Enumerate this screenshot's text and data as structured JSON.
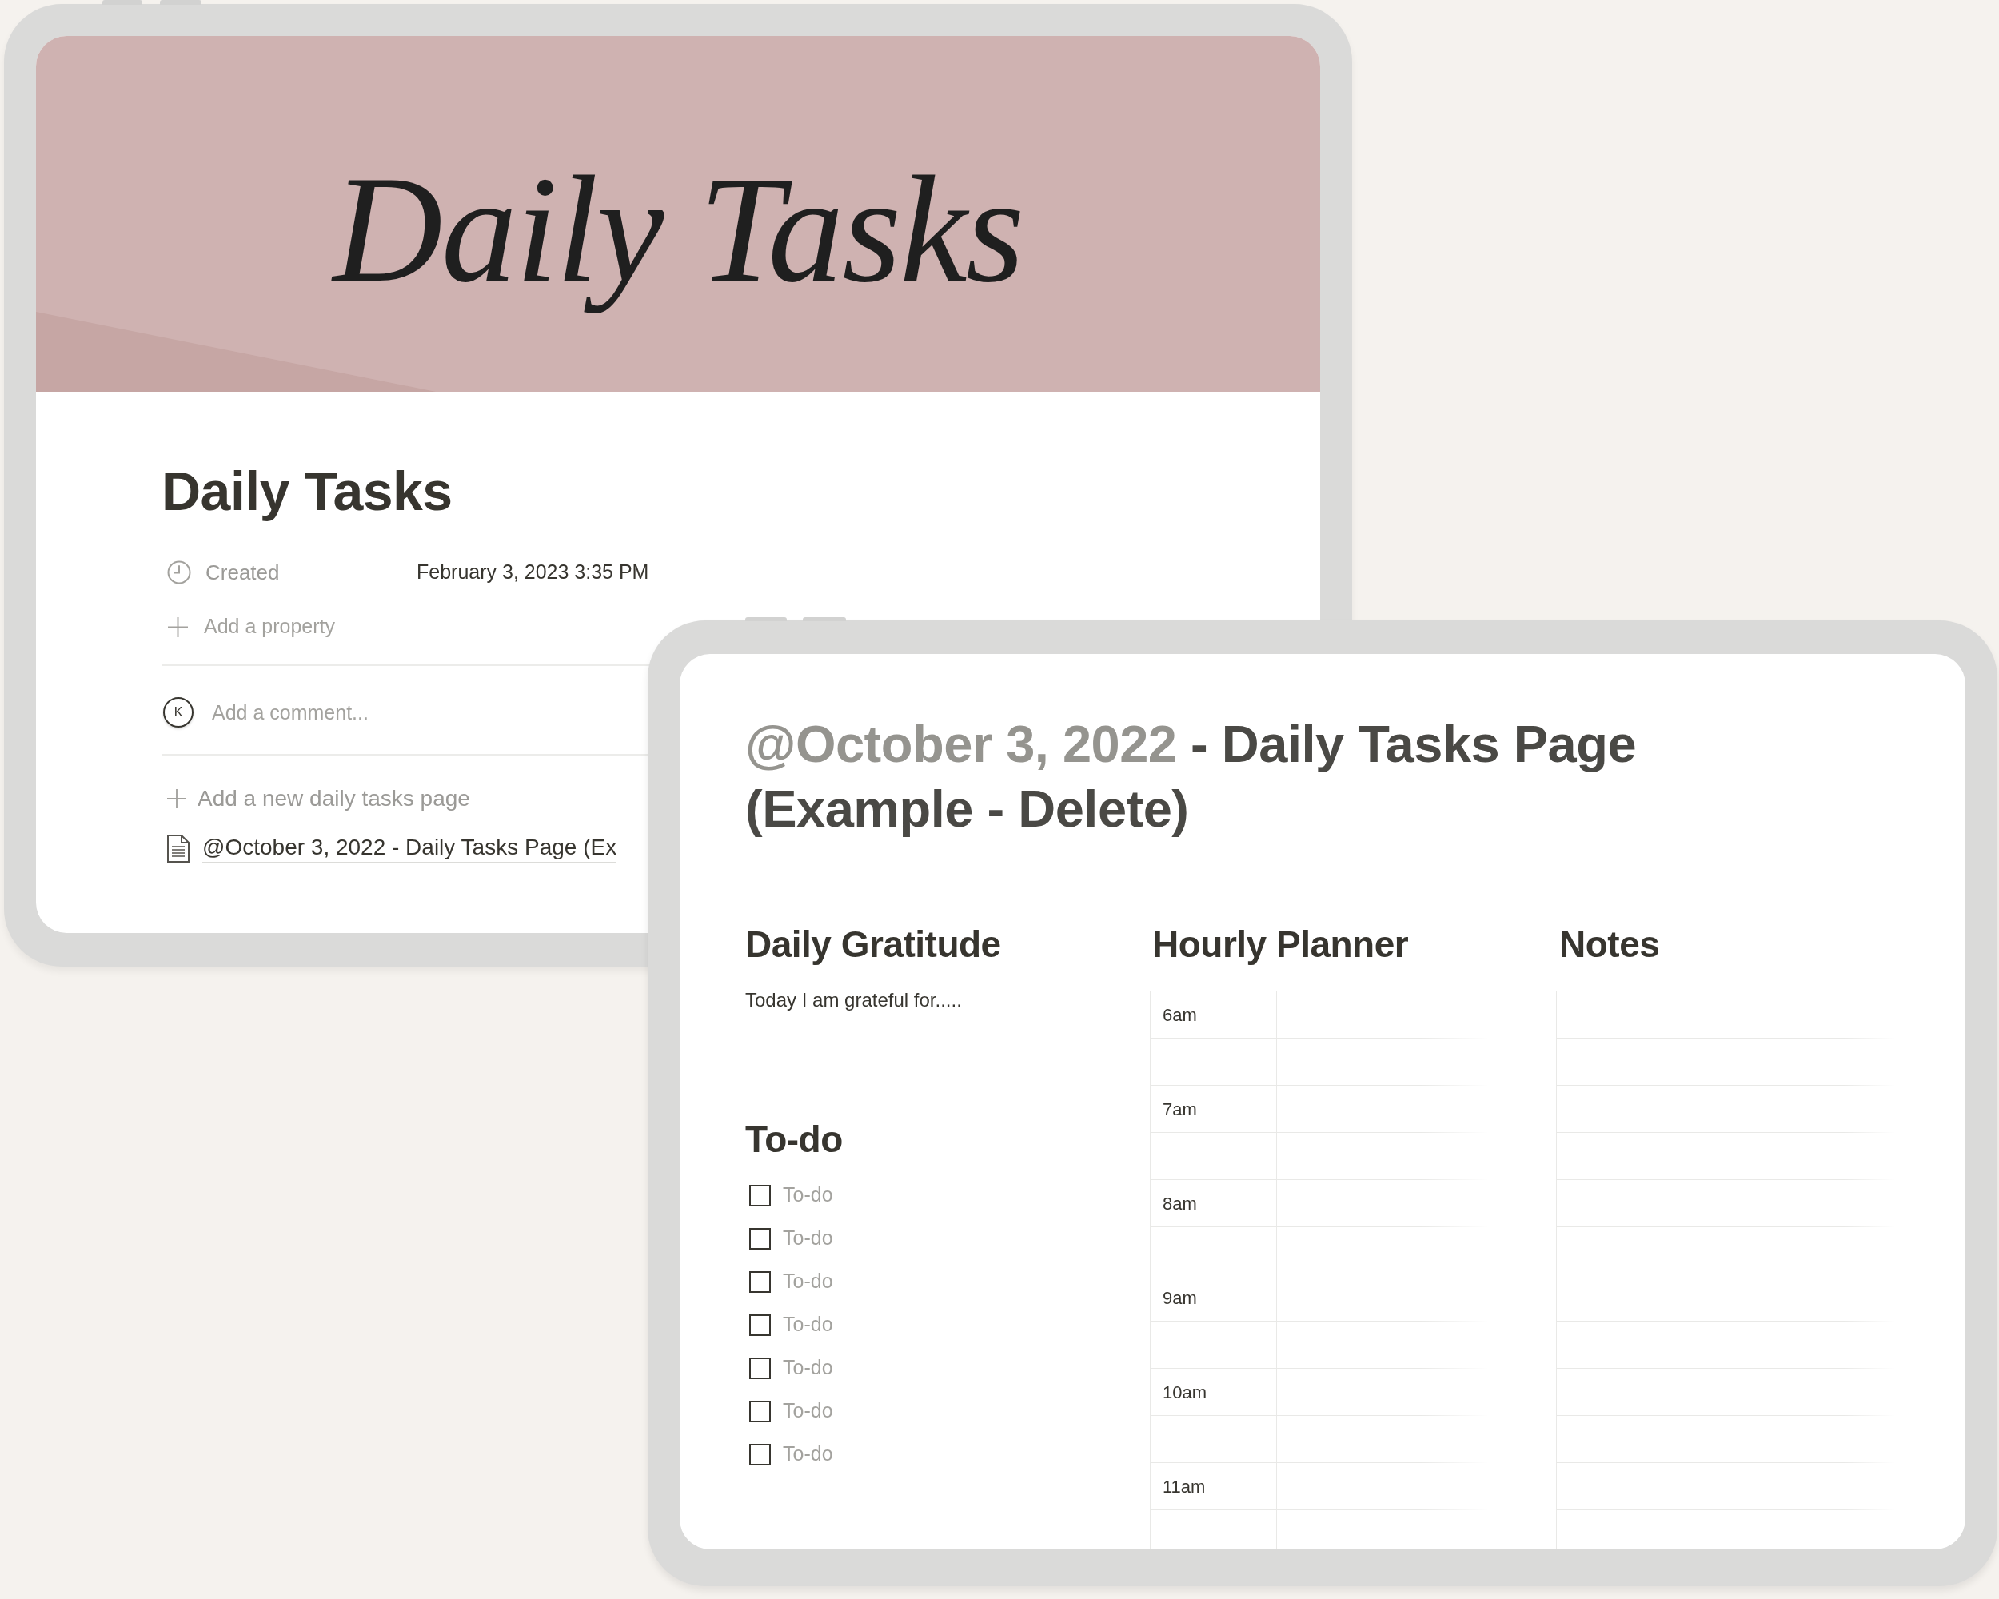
{
  "back_tablet": {
    "cover": {
      "title": "Daily Tasks"
    },
    "title": "Daily Tasks",
    "properties": [
      {
        "label": "Created",
        "value": "February 3, 2023 3:35 PM"
      }
    ],
    "add_property": "Add a property",
    "comment": {
      "avatar": "K",
      "placeholder": "Add a comment..."
    },
    "add_page": "Add a new daily tasks page",
    "pages": [
      {
        "title": "@October 3, 2022 - Daily Tasks Page (Ex"
      }
    ]
  },
  "front_tablet": {
    "title": {
      "mention": "@October 3, 2022",
      "text": "- Daily Tasks Page (Example - Delete)"
    },
    "gratitude": {
      "heading": "Daily Gratitude",
      "text": "Today I am grateful for....."
    },
    "todo": {
      "heading": "To-do",
      "items": [
        {
          "label": "To-do",
          "checked": false
        },
        {
          "label": "To-do",
          "checked": false
        },
        {
          "label": "To-do",
          "checked": false
        },
        {
          "label": "To-do",
          "checked": false
        },
        {
          "label": "To-do",
          "checked": false
        },
        {
          "label": "To-do",
          "checked": false
        },
        {
          "label": "To-do",
          "checked": false
        }
      ]
    },
    "planner": {
      "heading": "Hourly Planner",
      "hours": [
        "6am",
        "7am",
        "8am",
        "9am",
        "10am",
        "11am"
      ]
    },
    "notes": {
      "heading": "Notes"
    }
  }
}
